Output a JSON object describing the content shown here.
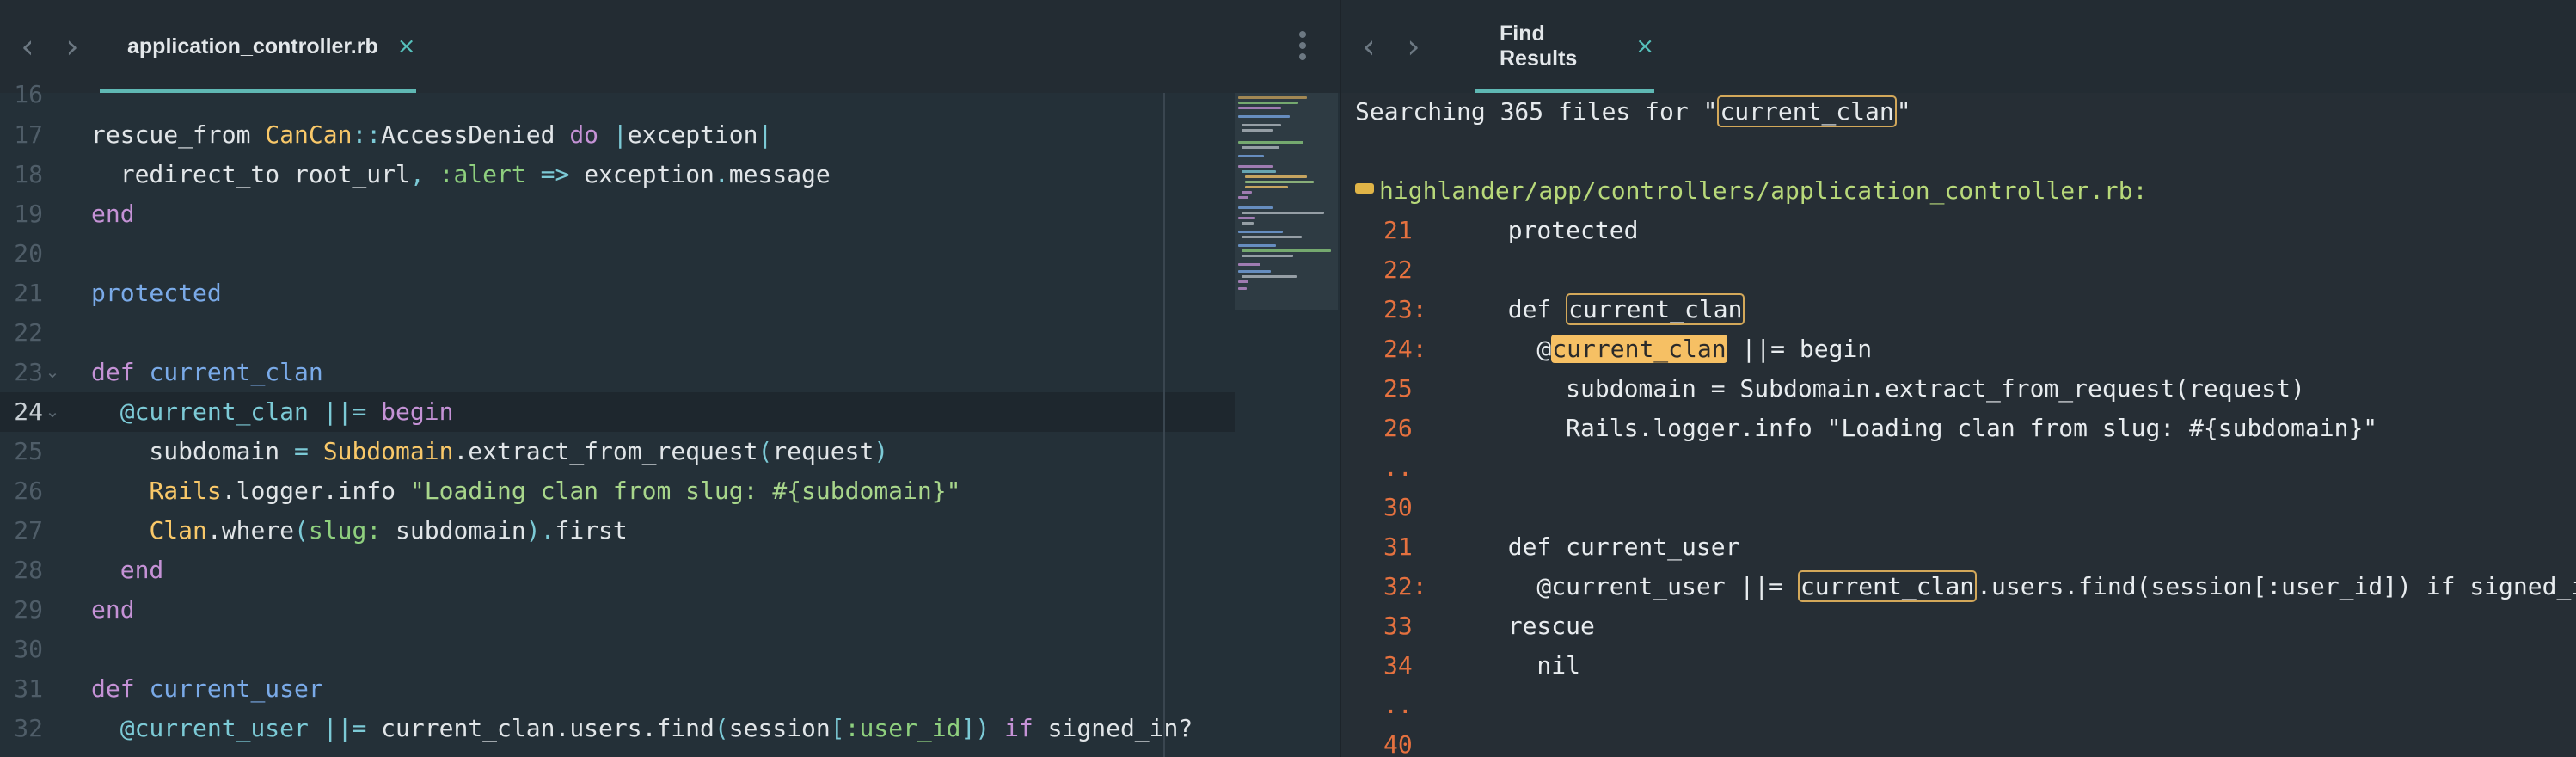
{
  "left_pane": {
    "tab": {
      "title": "application_controller.rb",
      "close": "×"
    },
    "nav_back": "‹",
    "nav_forward": "›",
    "line_numbers": [
      "16",
      "17",
      "18",
      "19",
      "20",
      "21",
      "22",
      "23",
      "24",
      "25",
      "26",
      "27",
      "28",
      "29",
      "30",
      "31",
      "32"
    ],
    "active_line_number": "24",
    "code": {
      "l17": {
        "a": "rescue_from ",
        "b": "CanCan",
        "c": "::",
        "d": "AccessDenied ",
        "e": "do ",
        "f": "|",
        "g": "exception",
        "h": "|"
      },
      "l18": {
        "a": "  redirect_to root_url",
        "b": ", ",
        "c": ":alert",
        "d": " => ",
        "e": "exception",
        "f": ".",
        "g": "message"
      },
      "l19": {
        "a": "end"
      },
      "l21": {
        "a": "protected"
      },
      "l23": {
        "a": "def ",
        "b": "current_clan"
      },
      "l24": {
        "a": "  @current_clan",
        "b": " ||= ",
        "c": "begin"
      },
      "l25": {
        "a": "    subdomain ",
        "b": "= ",
        "c": "Subdomain",
        "d": ".extract_from_request",
        "e": "(",
        "f": "request",
        "g": ")"
      },
      "l26": {
        "a": "    ",
        "b": "Rails",
        "c": ".logger.info ",
        "d": "\"Loading clan from slug: #{subdomain}\""
      },
      "l27": {
        "a": "    ",
        "b": "Clan",
        "c": ".where",
        "d": "(",
        "e": "slug:",
        "f": " subdomain",
        "g": ").",
        "h": "first"
      },
      "l28": {
        "a": "  end"
      },
      "l29": {
        "a": "end"
      },
      "l31": {
        "a": "def ",
        "b": "current_user"
      },
      "l32": {
        "a": "  @current_user",
        "b": " ||= ",
        "c": "current_clan.users.find",
        "d": "(",
        "e": "session",
        "f": "[",
        "g": ":user_id",
        "h": "])",
        "i": " if ",
        "j": "signed_in?"
      }
    }
  },
  "right_pane": {
    "tab": {
      "title": "Find Results",
      "close": "×"
    },
    "nav_back": "‹",
    "nav_forward": "›",
    "summary": {
      "prefix": "Searching 365 files for \"",
      "query": "current_clan",
      "suffix": "\""
    },
    "file_path": "highlander/app/controllers/application_controller.rb:",
    "results": [
      {
        "num": "21",
        "code": "  protected"
      },
      {
        "num": "22",
        "code": ""
      },
      {
        "num": "23:",
        "pre": "  def ",
        "match": "current_clan",
        "post": ""
      },
      {
        "num": "24:",
        "pre": "    @",
        "match": "current_clan",
        "post": " ||= begin"
      },
      {
        "num": "25",
        "code": "      subdomain = Subdomain.extract_from_request(request)"
      },
      {
        "num": "26",
        "code": "      Rails.logger.info \"Loading clan from slug: #{subdomain}\""
      },
      {
        "num": "..",
        "code": ""
      },
      {
        "num": "30",
        "code": ""
      },
      {
        "num": "31",
        "code": "  def current_user"
      },
      {
        "num": "32:",
        "pre": "    @current_user ||= ",
        "match": "current_clan",
        "post": ".users.find(session[:user_id]) if signed_in?"
      },
      {
        "num": "33",
        "code": "  rescue"
      },
      {
        "num": "34",
        "code": "    nil"
      },
      {
        "num": "..",
        "code": ""
      },
      {
        "num": "40",
        "code": ""
      }
    ]
  },
  "colors": {
    "keyword": "#c592d6",
    "class": "#f9c869",
    "function": "#7aaae8",
    "symbol": "#8ecf7e",
    "string": "#a8d68b",
    "line_number_result": "#e5713f",
    "path": "#b8d97a",
    "accent": "#5fb8b4"
  },
  "icons": {
    "fold": "fold-arrow-icon",
    "more": "vertical-ellipsis-icon",
    "ellipsis": "result-ellipsis-icon"
  }
}
